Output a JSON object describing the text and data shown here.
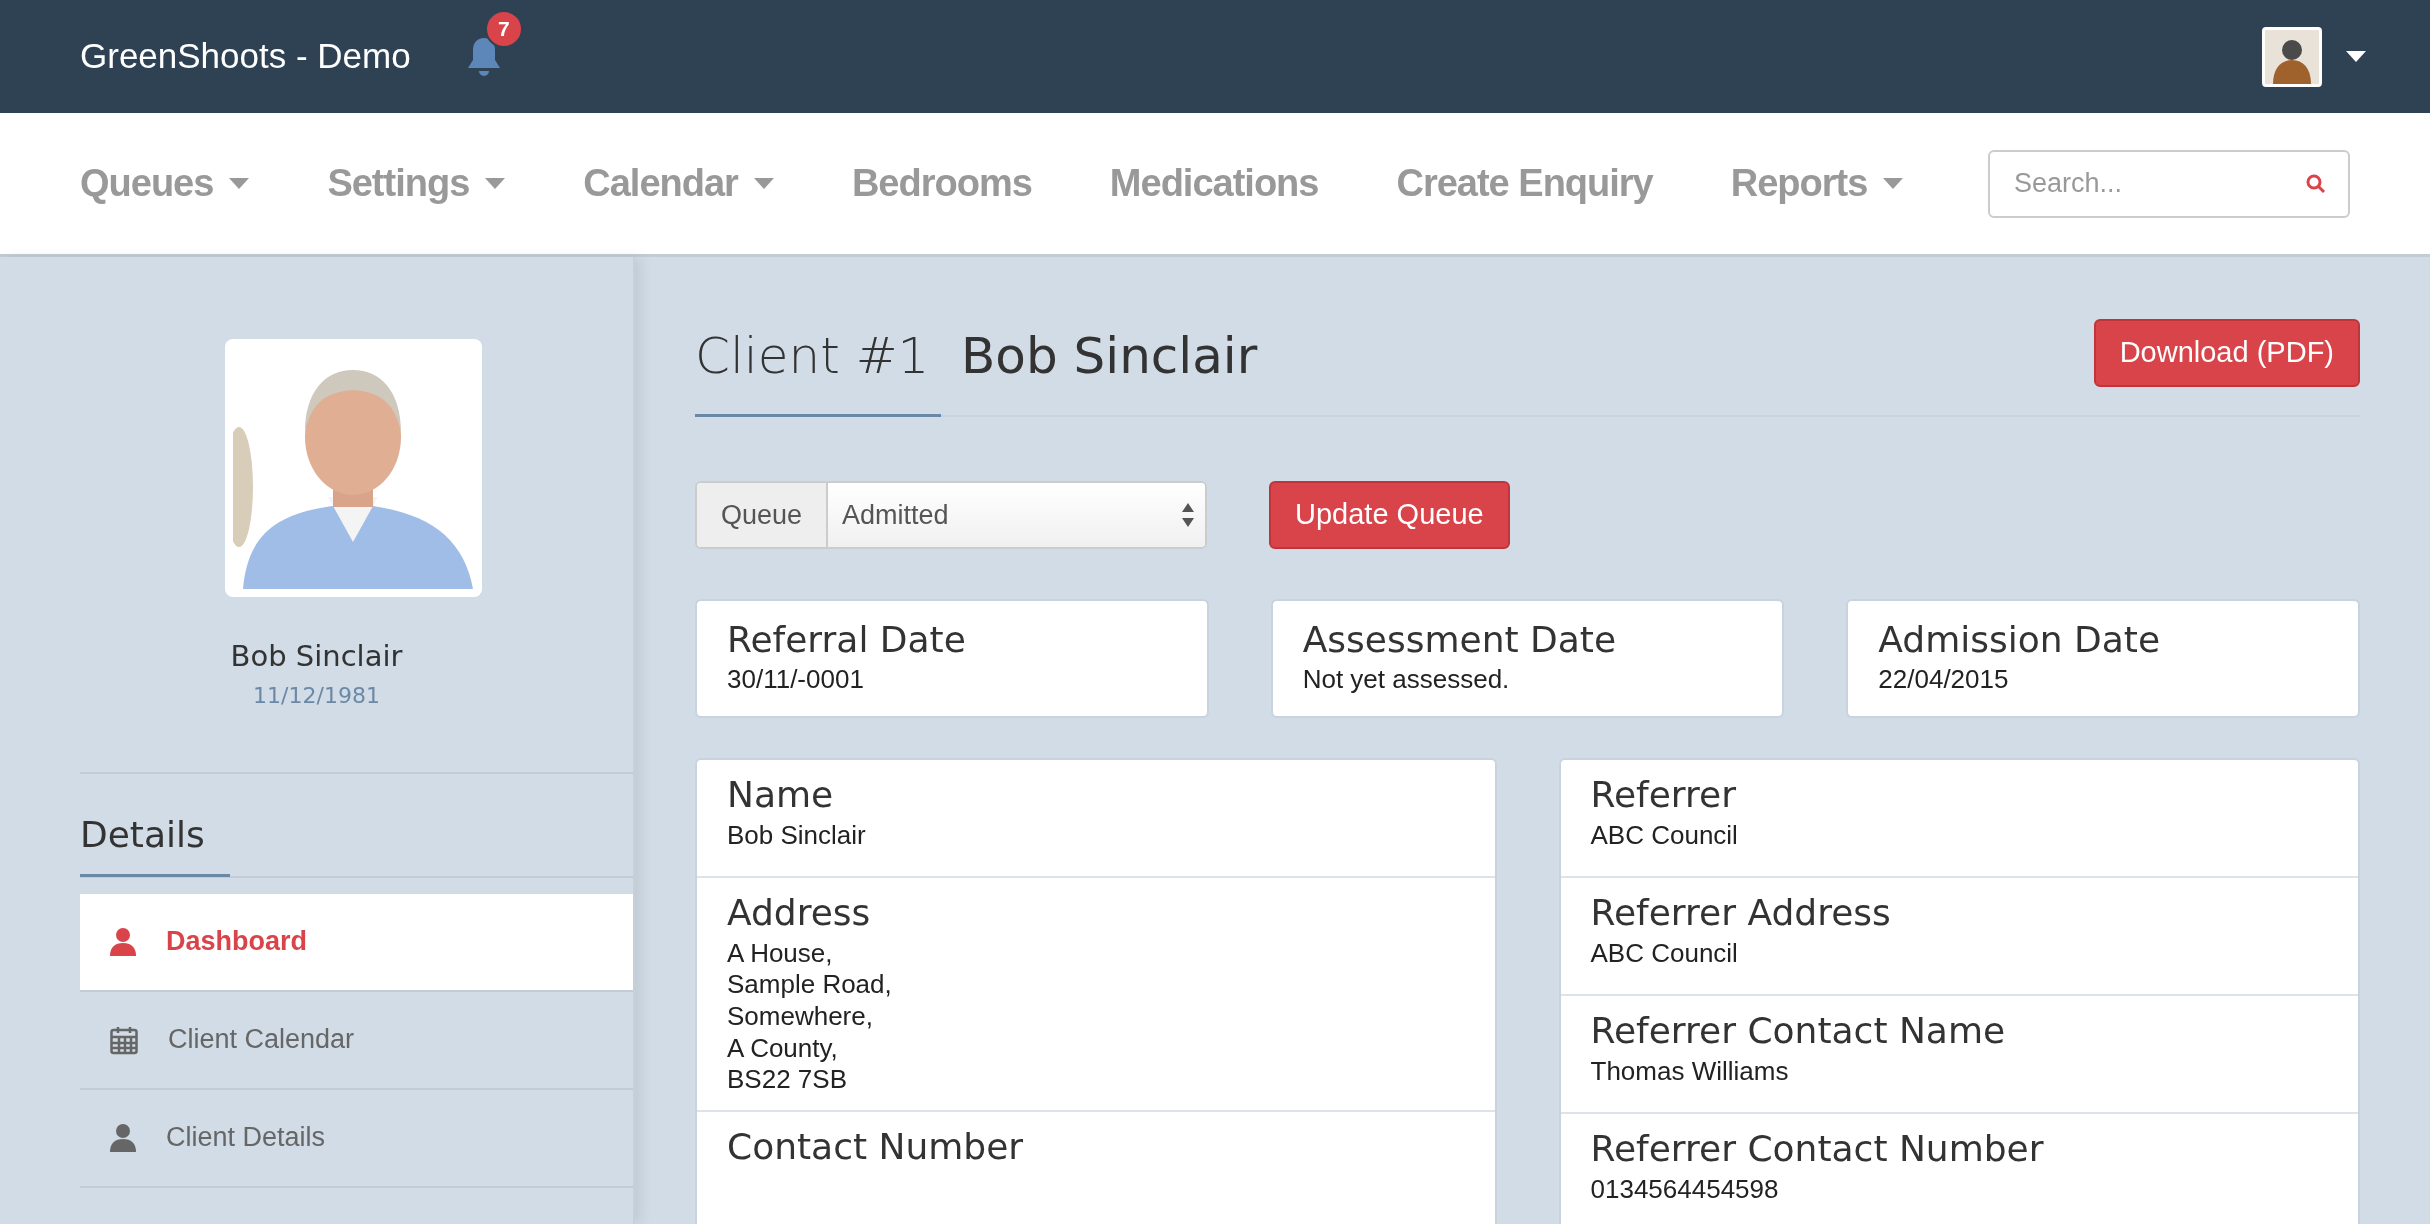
{
  "app": {
    "title": "GreenShoots - Demo",
    "notifications": "7"
  },
  "nav": [
    {
      "label": "Queues",
      "dropdown": true
    },
    {
      "label": "Settings",
      "dropdown": true
    },
    {
      "label": "Calendar",
      "dropdown": true
    },
    {
      "label": "Bedrooms",
      "dropdown": false
    },
    {
      "label": "Medications",
      "dropdown": false
    },
    {
      "label": "Create Enquiry",
      "dropdown": false
    },
    {
      "label": "Reports",
      "dropdown": true
    }
  ],
  "search": {
    "placeholder": "Search..."
  },
  "client": {
    "name": "Bob Sinclair",
    "dob": "11/12/1981"
  },
  "sidebar": {
    "heading": "Details",
    "items": [
      {
        "label": "Dashboard",
        "kind": "person",
        "selected": true
      },
      {
        "label": "Client Calendar",
        "kind": "calendar",
        "selected": false
      },
      {
        "label": "Client Details",
        "kind": "person",
        "selected": false
      }
    ]
  },
  "header": {
    "tab": "Client #1",
    "name": "Bob Sinclair",
    "download": "Download (PDF)"
  },
  "queue": {
    "label": "Queue",
    "value": "Admitted",
    "button": "Update Queue"
  },
  "dates": [
    {
      "title": "Referral Date",
      "value": "30/11/-0001"
    },
    {
      "title": "Assessment Date",
      "value": "Not yet assessed."
    },
    {
      "title": "Admission Date",
      "value": "22/04/2015"
    }
  ],
  "details_left": [
    {
      "title": "Name",
      "value": "Bob Sinclair"
    },
    {
      "title": "Address",
      "value": "A House,\nSample Road,\nSomewhere,\nA County,\nBS22 7SB"
    },
    {
      "title": "Contact Number"
    }
  ],
  "details_right": [
    {
      "title": "Referrer",
      "value": "ABC Council"
    },
    {
      "title": "Referrer Address",
      "value": "ABC Council"
    },
    {
      "title": "Referrer Contact Name",
      "value": "Thomas Williams"
    },
    {
      "title": "Referrer Contact Number",
      "value": "0134564454598"
    }
  ]
}
